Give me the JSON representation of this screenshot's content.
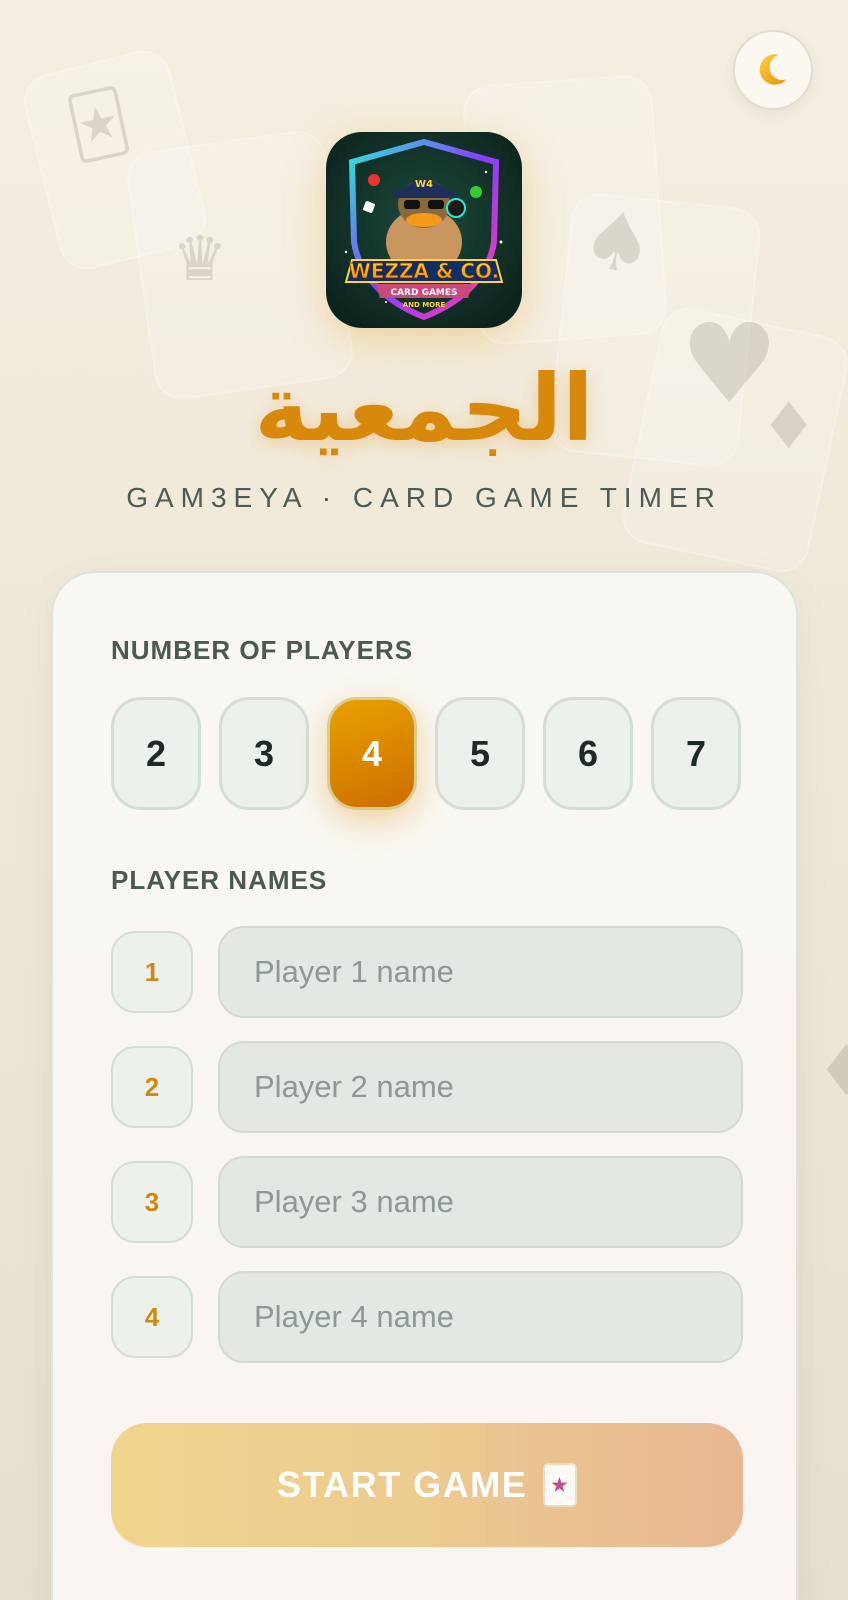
{
  "header": {
    "theme_toggle_icon": "crescent-moon-icon",
    "logo": {
      "main": "WEZZA & CO.",
      "tagline_top": "CARD GAMES",
      "tagline_bottom": "AND MORE",
      "cap_text": "W4"
    },
    "title": "الجمعية",
    "subtitle": "GAM3EYA · CARD GAME TIMER"
  },
  "players": {
    "count_label": "NUMBER OF PLAYERS",
    "count_options": [
      "2",
      "3",
      "4",
      "5",
      "6",
      "7"
    ],
    "selected_count": "4",
    "names_label": "PLAYER NAMES",
    "rows": [
      {
        "number": "1",
        "placeholder": "Player 1 name",
        "value": ""
      },
      {
        "number": "2",
        "placeholder": "Player 2 name",
        "value": ""
      },
      {
        "number": "3",
        "placeholder": "Player 3 name",
        "value": ""
      },
      {
        "number": "4",
        "placeholder": "Player 4 name",
        "value": ""
      }
    ]
  },
  "actions": {
    "start_label": "START GAME",
    "start_icon": "joker-card-icon"
  },
  "colors": {
    "accent": "#d8890b",
    "selected_gradient_start": "#e8a200",
    "selected_gradient_end": "#cc6e00",
    "label_text": "#4a5a52"
  }
}
